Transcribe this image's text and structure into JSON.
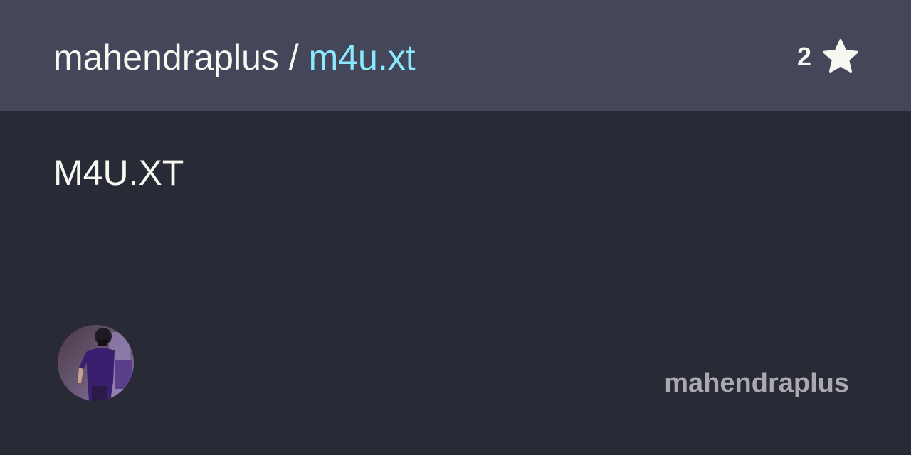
{
  "header": {
    "owner": "mahendraplus",
    "separator": " / ",
    "repo": "m4u.xt",
    "star_count": "2",
    "star_icon": "star-icon"
  },
  "description": "M4U.XT",
  "footer": {
    "avatar_icon": "avatar",
    "owner_name": "mahendraplus"
  },
  "colors": {
    "header_bg": "#44475a",
    "body_bg": "#282a36",
    "repo_accent": "#8be9fd",
    "text": "#f8f8f2",
    "muted_text": "#a9a9ae"
  }
}
